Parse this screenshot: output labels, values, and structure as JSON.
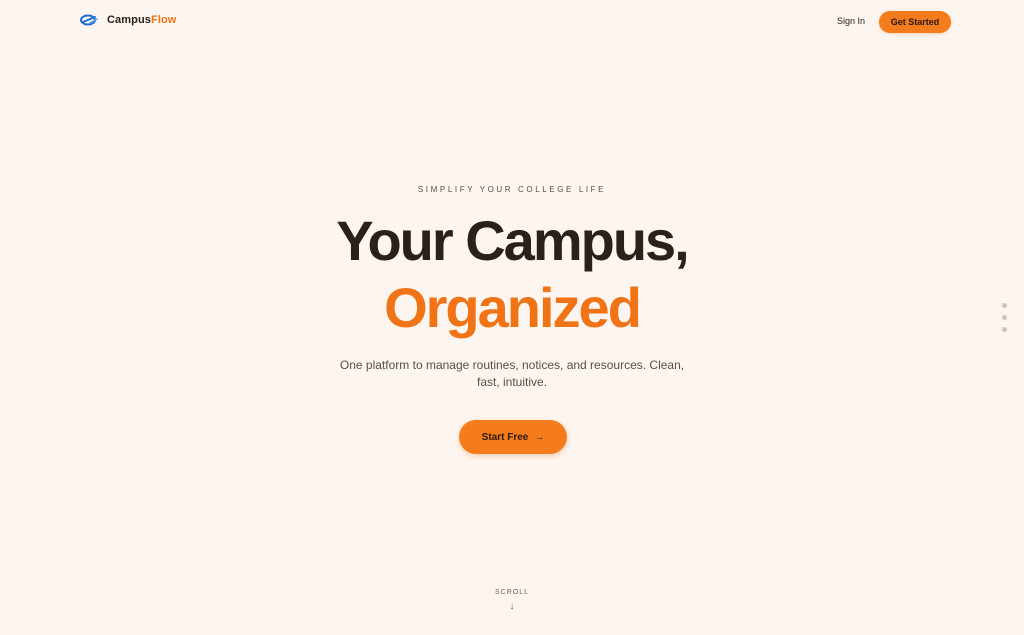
{
  "header": {
    "logo_icon": "campusflow-logo-icon",
    "brand_main": "Campus",
    "brand_accent": "Flow",
    "signin_label": "Sign In",
    "cta_label": "Get Started"
  },
  "hero": {
    "eyebrow": "SIMPLIFY YOUR COLLEGE LIFE",
    "title_line1": "Your Campus,",
    "title_line2": "Organized",
    "subtitle": "One platform to manage routines, notices, and resources. Clean, fast, intuitive.",
    "cta_label": "Start Free",
    "cta_arrow": "→"
  },
  "section_nav": {
    "dots": [
      "section-1",
      "section-2",
      "section-3"
    ]
  },
  "scroll": {
    "label": "SCROLL",
    "arrow": "↓"
  },
  "colors": {
    "background": "#fdf5ef",
    "accent": "#f07416",
    "button": "#f57c1c",
    "text": "#2a211d",
    "muted": "#5a4f49"
  }
}
